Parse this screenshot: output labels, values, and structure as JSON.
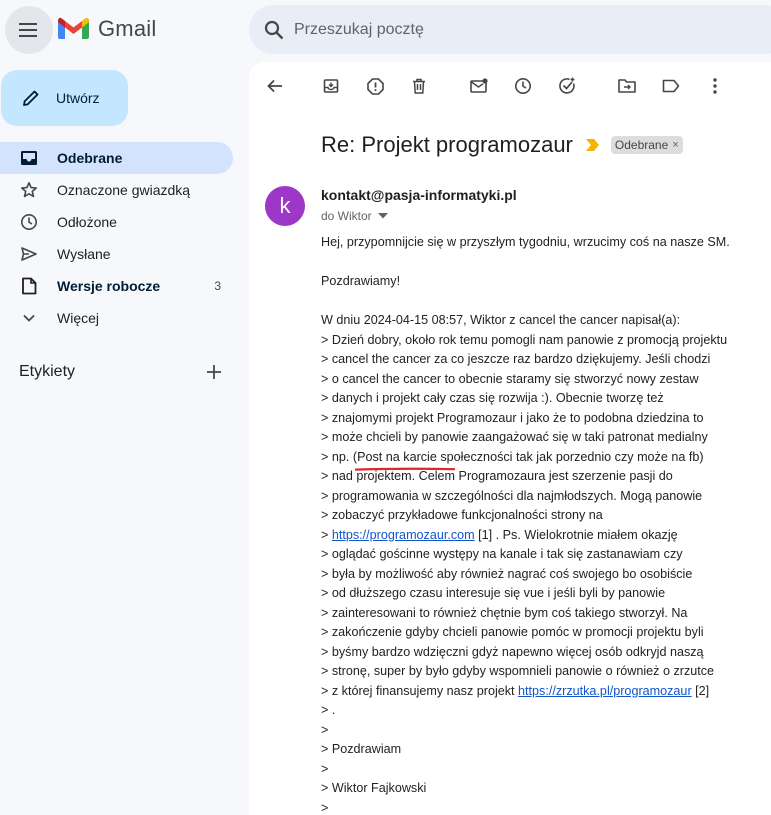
{
  "app": {
    "name": "Gmail",
    "colors": {
      "accent": "#c2e7ff",
      "active_nav": "#d3e3fd",
      "avatar": "#9c37c8",
      "link": "#1155cc",
      "marker": "#f4b400",
      "annotation": "#e0262b"
    }
  },
  "header": {
    "menu_icon": "hamburger-icon",
    "logo_text": "Gmail",
    "search_placeholder": "Przeszukaj pocztę"
  },
  "sidebar": {
    "compose_label": "Utwórz",
    "items": [
      {
        "label": "Odebrane",
        "icon": "inbox-icon",
        "active": true,
        "count": ""
      },
      {
        "label": "Oznaczone gwiazdką",
        "icon": "star-icon",
        "active": false,
        "count": ""
      },
      {
        "label": "Odłożone",
        "icon": "clock-icon",
        "active": false,
        "count": ""
      },
      {
        "label": "Wysłane",
        "icon": "send-icon",
        "active": false,
        "count": ""
      },
      {
        "label": "Wersje robocze",
        "icon": "draft-icon",
        "active": false,
        "bold": true,
        "count": "3"
      },
      {
        "label": "Więcej",
        "icon": "chevron-down-icon",
        "active": false,
        "count": ""
      }
    ],
    "labels_title": "Etykiety"
  },
  "toolbar": {
    "buttons": [
      "back-icon",
      "archive-icon",
      "report-spam-icon",
      "delete-icon",
      "mark-unread-icon",
      "snooze-icon",
      "add-task-icon",
      "move-to-icon",
      "label-icon",
      "more-vert-icon"
    ]
  },
  "message": {
    "subject": "Re: Projekt programozaur",
    "label_chip": "Odebrane",
    "label_chip_close": "×",
    "avatar_letter": "k",
    "sender": "kontakt@pasja-informatyki.pl",
    "recipient": "do Wiktor",
    "body": {
      "l1": "Hej, przypomnijcie się w przyszłym tygodniu, wrzucimy coś na nasze SM.",
      "l2": "Pozdrawiamy!",
      "l3": "W dniu 2024-04-15 08:57, Wiktor z cancel the cancer napisał(a):",
      "q1": "> Dzień dobry, około rok temu pomogli nam panowie z promocją projektu",
      "q2": "> cancel the cancer za co jeszcze raz bardzo dziękujemy. Jeśli chodzi",
      "q3": "> o cancel the cancer to obecnie staramy się stworzyć nowy zestaw",
      "q4": "> danych i projekt cały czas się rozwija :). Obecnie tworzę też",
      "q5": "> znajomymi projekt Programozaur i jako że to podobna dziedzina to",
      "q6": "> może chcieli by panowie zaangażować się w taki patronat medialny",
      "q7_pre": "> np. (",
      "q7_hl": "Post na karcie społeczności",
      "q7_post": " tak jak porzednio czy może na fb)",
      "q8": "> nad projektem. Celem Programozaura jest szerzenie pasji do",
      "q9": "> programowania w szczególności dla najmłodszych. Mogą panowie",
      "q10": "> zobaczyć przykładowe funkcjonalności strony na",
      "q11_pre": "> ",
      "q11_link": "https://programozaur.com",
      "q11_post": " [1] . Ps. Wielokrotnie miałem okazję",
      "q12": "> oglądać gościnne występy na kanale i tak się zastanawiam czy",
      "q13": "> była by możliwość aby również nagrać coś swojego bo osobiście",
      "q14": "> od dłuższego czasu interesuje się vue i jeśli byli by panowie",
      "q15": "> zainteresowani to również chętnie bym coś takiego stworzył. Na",
      "q16": "> zakończenie gdyby chcieli panowie pomóc w promocji projektu byli",
      "q17": "> byśmy bardzo wdzięczni gdyż napewno więcej osób odkryjd naszą",
      "q18": "> stronę, super by było gdyby wspomnieli panowie o również o zrzutce",
      "q19_pre": "> z której finansujemy nasz projekt ",
      "q19_link": "https://zrzutka.pl/programozaur",
      "q19_post": " [2]",
      "q20": "> .",
      "q21": ">",
      "q22": "> Pozdrawiam",
      "q23": ">",
      "q24": "> Wiktor Fajkowski",
      "q25": ">"
    }
  }
}
